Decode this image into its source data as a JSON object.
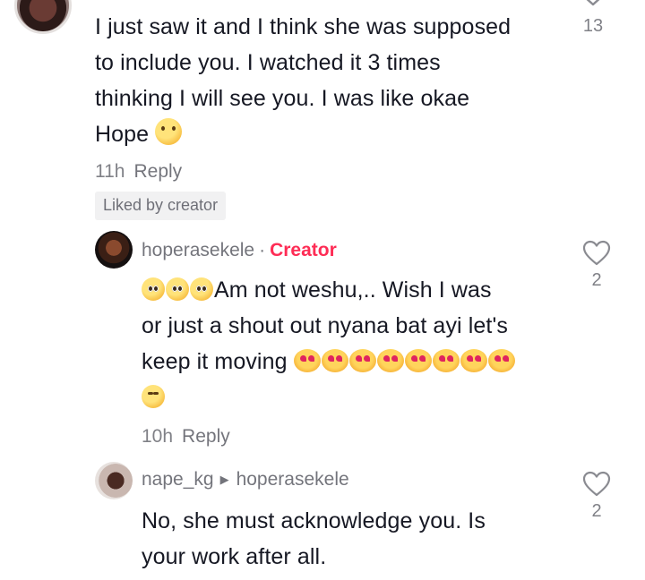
{
  "comments": {
    "main": {
      "lines": [
        "I just saw it and I think she was supposed",
        "to include you. I watched it 3 times",
        "thinking I will see you. I was like okae",
        "Hope"
      ],
      "time": "11h",
      "reply_label": "Reply",
      "liked_badge": "Liked by creator",
      "like_count": "13"
    },
    "reply1": {
      "username": "hoperasekele",
      "separator": "·",
      "creator_label": "Creator",
      "lines": [
        "Am not weshu,.. Wish I was",
        "or just a shout out nyana bat ayi let's",
        "keep it moving"
      ],
      "time": "10h",
      "reply_label": "Reply",
      "like_count": "2"
    },
    "reply2": {
      "username": "nape_kg",
      "reply_to": "hoperasekele",
      "lines": [
        "No, she must acknowledge you. Is",
        "your work after all."
      ],
      "like_count": "2"
    }
  },
  "icons": {
    "like": "heart-outline-icon",
    "reply_arrow": "triangle-right-icon"
  },
  "colors": {
    "creator_accent": "#fe2c55",
    "text_primary": "#161823",
    "text_secondary": "#8a8b91"
  }
}
